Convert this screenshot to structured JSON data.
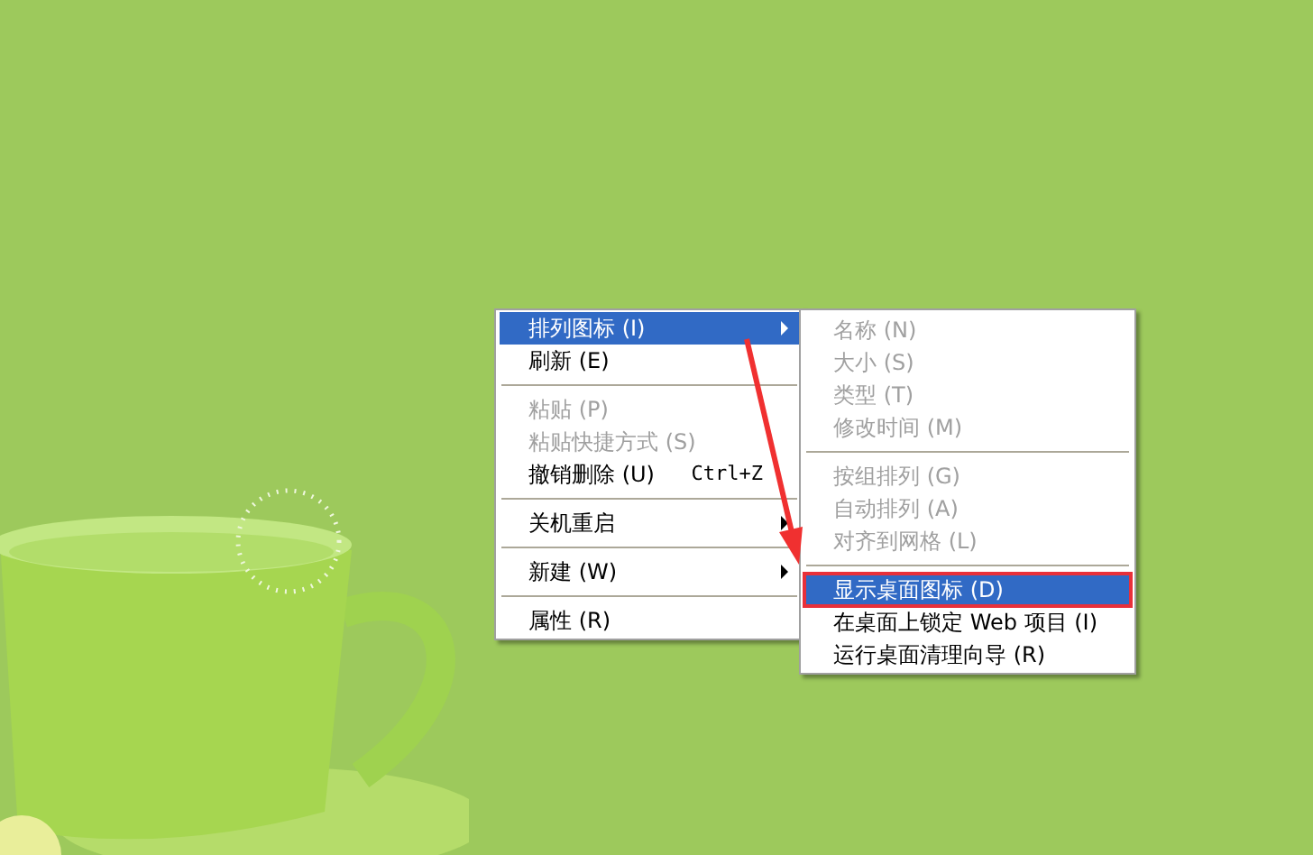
{
  "context_menu": {
    "items": [
      {
        "kind": "item",
        "label": "排列图标 (I)",
        "selected": true,
        "disabled": false,
        "submenu": true
      },
      {
        "kind": "item",
        "label": "刷新 (E)",
        "selected": false,
        "disabled": false,
        "submenu": false
      },
      {
        "kind": "separator"
      },
      {
        "kind": "item",
        "label": "粘贴 (P)",
        "selected": false,
        "disabled": true,
        "submenu": false
      },
      {
        "kind": "item",
        "label": "粘贴快捷方式 (S)",
        "selected": false,
        "disabled": true,
        "submenu": false
      },
      {
        "kind": "item",
        "label": "撤销删除 (U)",
        "shortcut": "Ctrl+Z",
        "selected": false,
        "disabled": false,
        "submenu": false
      },
      {
        "kind": "separator"
      },
      {
        "kind": "item",
        "label": "关机重启",
        "selected": false,
        "disabled": false,
        "submenu": true
      },
      {
        "kind": "separator"
      },
      {
        "kind": "item",
        "label": "新建 (W)",
        "selected": false,
        "disabled": false,
        "submenu": true
      },
      {
        "kind": "separator"
      },
      {
        "kind": "item",
        "label": "属性 (R)",
        "selected": false,
        "disabled": false,
        "submenu": false
      }
    ]
  },
  "submenu": {
    "items": [
      {
        "kind": "item",
        "label": "名称 (N)",
        "selected": false,
        "disabled": true,
        "outlined": false
      },
      {
        "kind": "item",
        "label": "大小 (S)",
        "selected": false,
        "disabled": true,
        "outlined": false
      },
      {
        "kind": "item",
        "label": "类型 (T)",
        "selected": false,
        "disabled": true,
        "outlined": false
      },
      {
        "kind": "item",
        "label": "修改时间 (M)",
        "selected": false,
        "disabled": true,
        "outlined": false
      },
      {
        "kind": "separator"
      },
      {
        "kind": "item",
        "label": "按组排列 (G)",
        "selected": false,
        "disabled": true,
        "outlined": false
      },
      {
        "kind": "item",
        "label": "自动排列 (A)",
        "selected": false,
        "disabled": true,
        "outlined": false
      },
      {
        "kind": "item",
        "label": "对齐到网格 (L)",
        "selected": false,
        "disabled": true,
        "outlined": false
      },
      {
        "kind": "separator"
      },
      {
        "kind": "item",
        "label": "显示桌面图标 (D)",
        "selected": true,
        "disabled": false,
        "outlined": true
      },
      {
        "kind": "item",
        "label": "在桌面上锁定 Web 项目 (I)",
        "selected": false,
        "disabled": false,
        "outlined": false
      },
      {
        "kind": "item",
        "label": "运行桌面清理向导 (R)",
        "selected": false,
        "disabled": false,
        "outlined": false
      }
    ]
  }
}
